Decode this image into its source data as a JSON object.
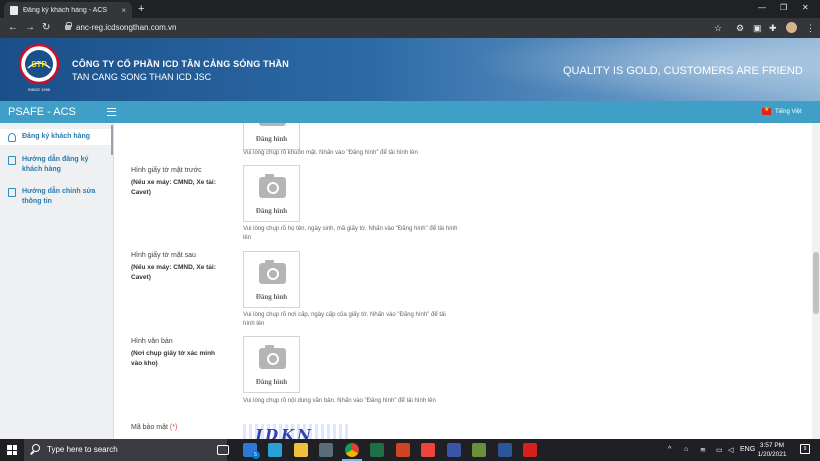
{
  "browser": {
    "tab_title": "Đăng ký khách hàng - ACS",
    "tab_close": "×",
    "new_tab": "+",
    "url": "anc-reg.icdsongthan.com.vn",
    "window_controls": [
      "—",
      "❐",
      "✕"
    ]
  },
  "header": {
    "company_name": "CÔNG TY CỔ PHẦN ICD TÂN CẢNG SÓNG THẦN",
    "company_name_en": "TAN CANG SONG THAN ICD JSC",
    "slogan": "QUALITY IS GOLD, CUSTOMERS ARE FRIEND",
    "logo": {
      "monogram": "STP",
      "caption": "SINCE 1995"
    }
  },
  "appbar": {
    "title": "PSAFE - ACS",
    "language": "Tiếng Việt"
  },
  "sidebar": {
    "items": [
      {
        "label": "Đăng ký khách hàng",
        "icon": "user-icon",
        "active": true
      },
      {
        "label": "Hướng dẫn đăng ký khách hàng",
        "icon": "document-icon",
        "active": false
      },
      {
        "label": "Hướng dẫn chỉnh sửa thông tin",
        "icon": "edit-icon",
        "active": false
      }
    ]
  },
  "form": {
    "face_photo": {
      "upload_label": "Đăng hình",
      "hint": "Vui lòng chụp rõ khuôn mặt. Nhấn vào \"Đăng hình\" để tải hình lên"
    },
    "id_front": {
      "label": "Hình giấy tờ mặt trước",
      "note": "(Nếu xe máy: CMND, Xe tải: Cavet)",
      "upload_label": "Đăng hình",
      "hint": "Vui lòng chụp rõ họ tên, ngày sinh, mã giấy tờ. Nhấn vào \"Đăng hình\" để tải hình lên"
    },
    "id_back": {
      "label": "Hình giấy tờ mặt sau",
      "note": "(Nếu xe máy: CMND, Xe tải: Cavet)",
      "upload_label": "Đăng hình",
      "hint": "Vui lòng chụp rõ nơi cấp, ngày cấp của giấy tờ. Nhấn vào \"Đăng hình\" để tải hình lên"
    },
    "document": {
      "label": "Hình văn bản",
      "note": "(Nơi chụp giấy tờ xác minh vào kho)",
      "upload_label": "Đăng hình",
      "hint": "Vui lòng chụp rõ nội dung văn bản. Nhấn vào \"Đăng hình\" để tải hình lên"
    },
    "captcha": {
      "label": "Mã bảo mật",
      "required_mark": "(*)",
      "image_text": "JDKN"
    }
  },
  "taskbar": {
    "search_placeholder": "Type here to search",
    "mail_badge": "5",
    "language": "ENG",
    "time": "3:57 PM",
    "date": "1/20/2021",
    "notification_count": "9",
    "apps": [
      {
        "name": "task-view-icon",
        "color": "#ffffff"
      },
      {
        "name": "mail-icon",
        "color": "#2b79d3"
      },
      {
        "name": "skype-icon",
        "color": "#2a9fd8"
      },
      {
        "name": "file-explorer-icon",
        "color": "#f0c040"
      },
      {
        "name": "photos-icon",
        "color": "#5a6b7a"
      },
      {
        "name": "chrome-icon",
        "color": "#e8453c"
      },
      {
        "name": "excel-icon",
        "color": "#1e7145"
      },
      {
        "name": "powerpoint-icon",
        "color": "#d04423"
      },
      {
        "name": "anydesk-icon",
        "color": "#ef443b"
      },
      {
        "name": "visio-icon",
        "color": "#3955a3"
      },
      {
        "name": "app-icon",
        "color": "#6b8f3a"
      },
      {
        "name": "word-icon",
        "color": "#2b579a"
      },
      {
        "name": "pdf-icon",
        "color": "#d7201d"
      }
    ]
  }
}
